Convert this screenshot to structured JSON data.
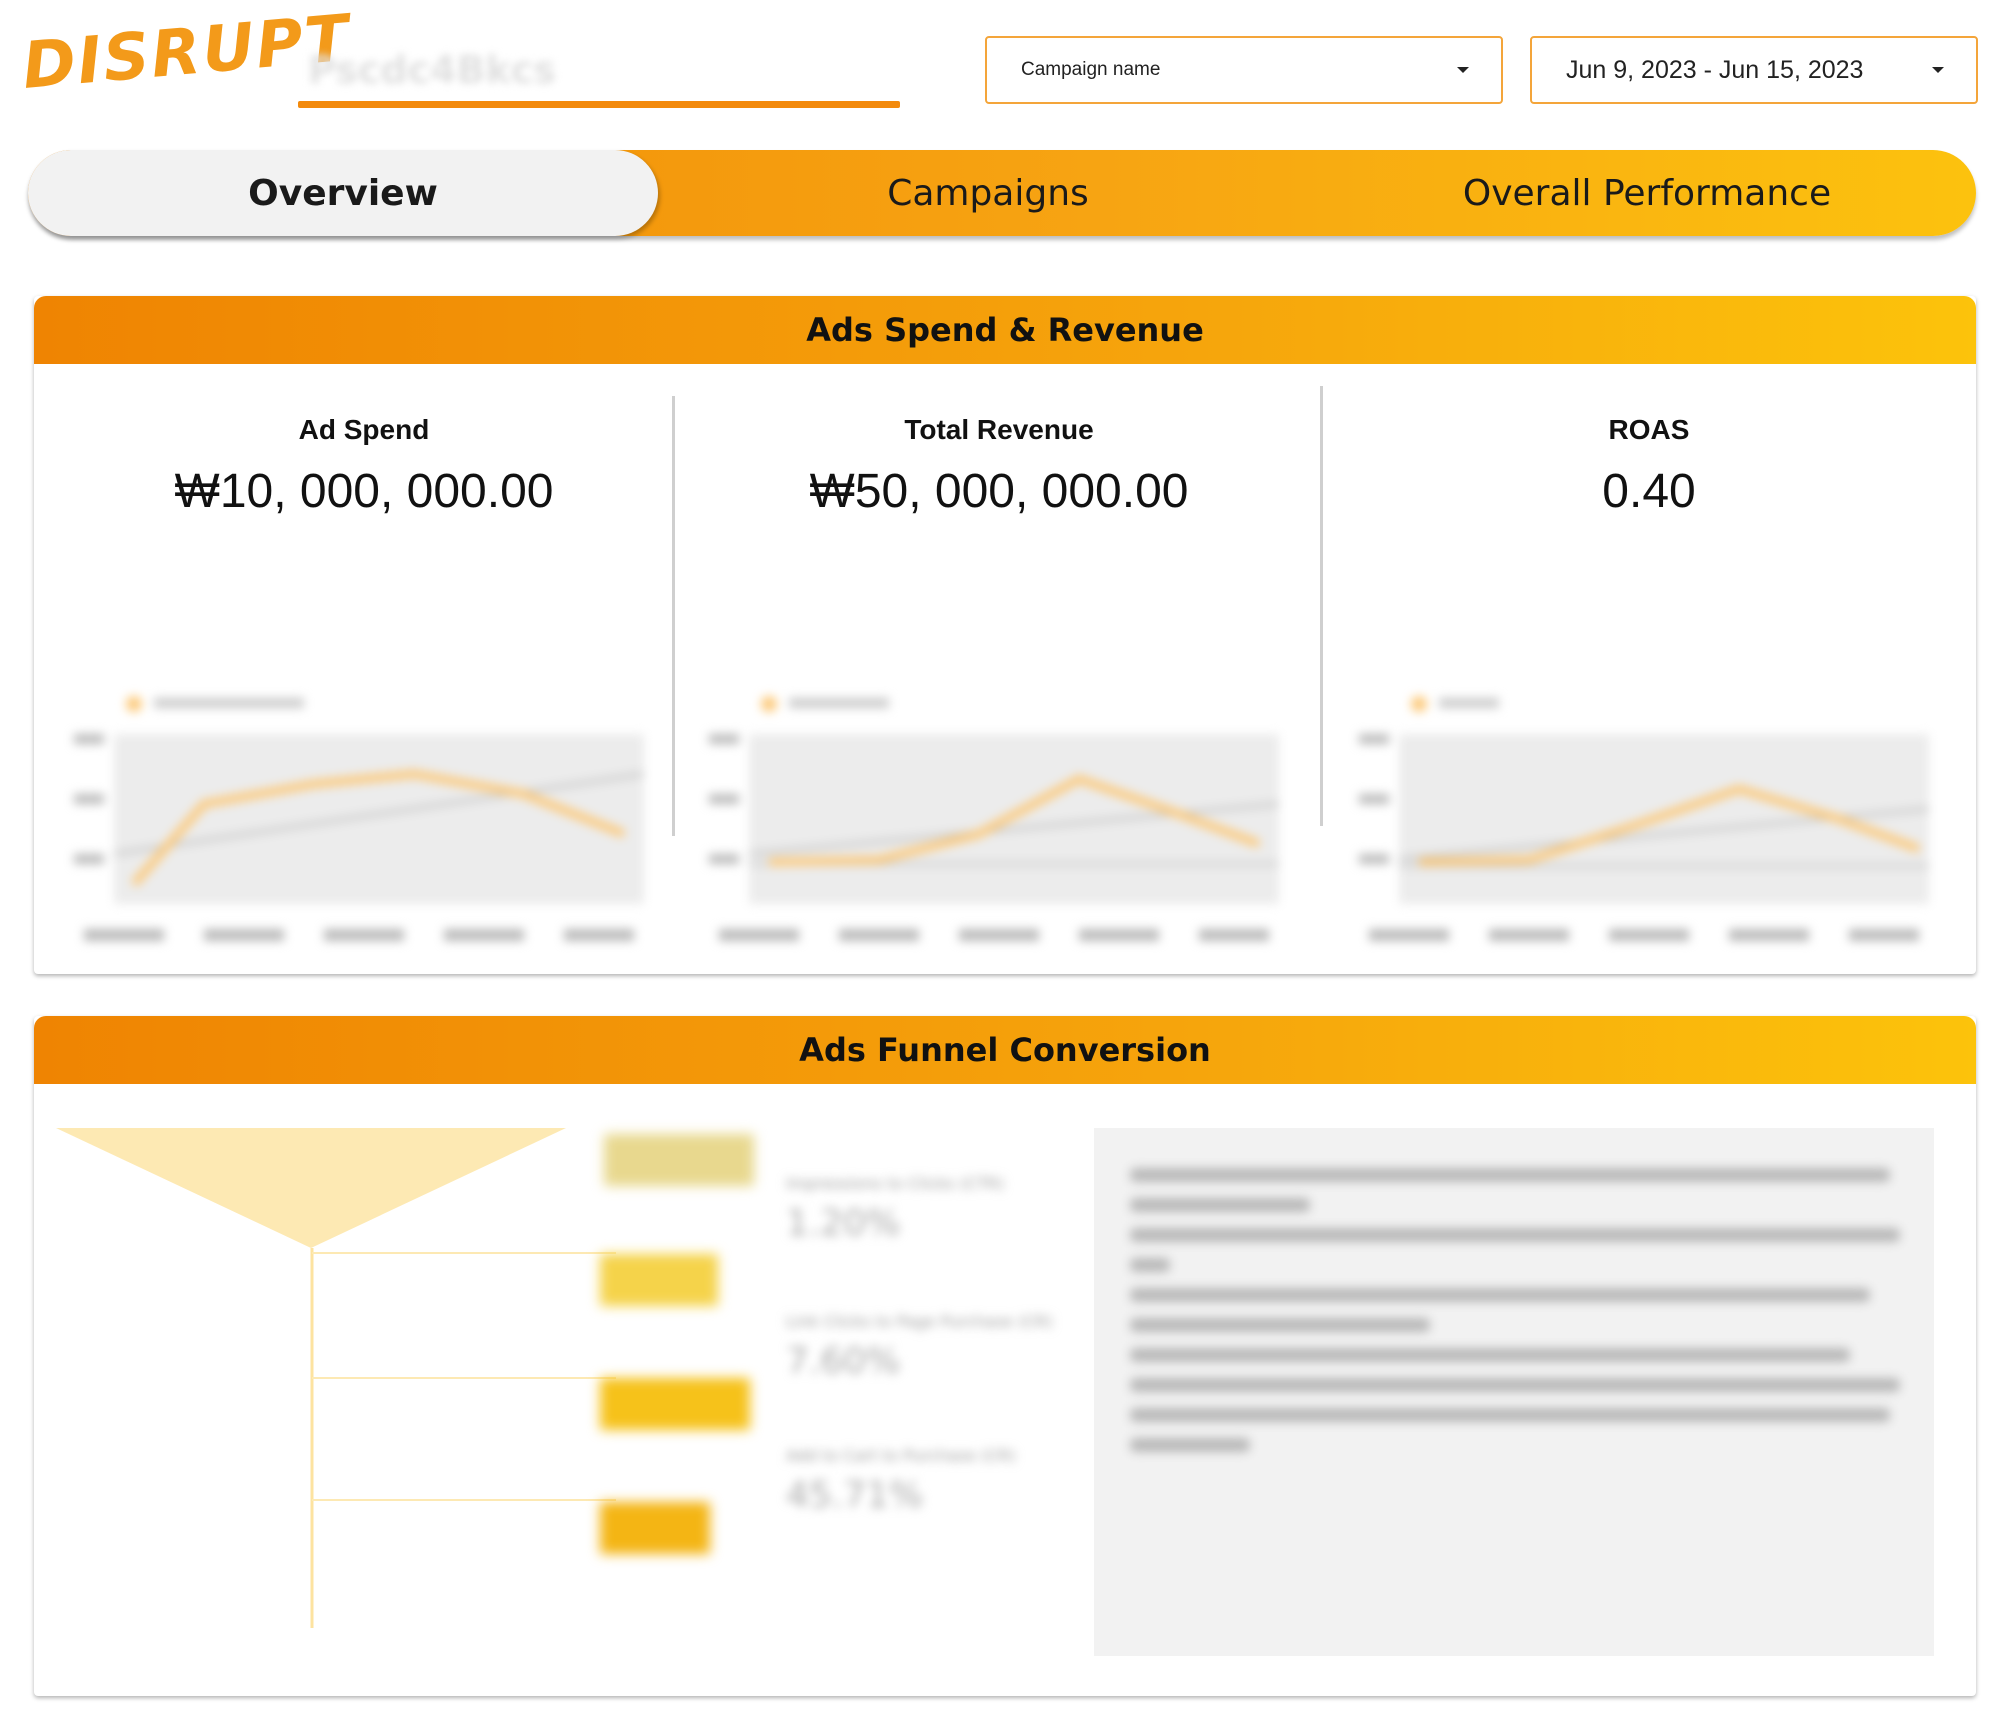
{
  "header": {
    "logo_text": "DISRUPT",
    "brand_placeholder": "Pscdc4Bkcs",
    "campaign_dropdown": {
      "label": "Campaign name"
    },
    "date_dropdown": {
      "label": "Jun 9, 2023 - Jun 15, 2023"
    }
  },
  "tabs": [
    {
      "label": "Overview",
      "active": true
    },
    {
      "label": "Campaigns",
      "active": false
    },
    {
      "label": "Overall Performance",
      "active": false
    }
  ],
  "spend_section": {
    "title": "Ads Spend & Revenue",
    "kpis": [
      {
        "title": "Ad Spend",
        "value": "₩10, 000, 000.00"
      },
      {
        "title": "Total Revenue",
        "value": "₩50, 000, 000.00"
      },
      {
        "title": "ROAS",
        "value": "0.40"
      }
    ]
  },
  "funnel_section": {
    "title": "Ads Funnel Conversion",
    "stats": [
      {
        "label": "Impressions to Clicks (CTR)",
        "value": "1.20%"
      },
      {
        "label": "Link Clicks to Page Purchase (CR)",
        "value": "7.60%"
      },
      {
        "label": "Add to Cart to Purchase (CR)",
        "value": "45.71%"
      }
    ]
  },
  "colors": {
    "accent": "#f38a0c",
    "accent_light": "#fcc20e",
    "tab_active_bg": "#f2f2f2",
    "funnel_fill": "#fde9b3"
  }
}
